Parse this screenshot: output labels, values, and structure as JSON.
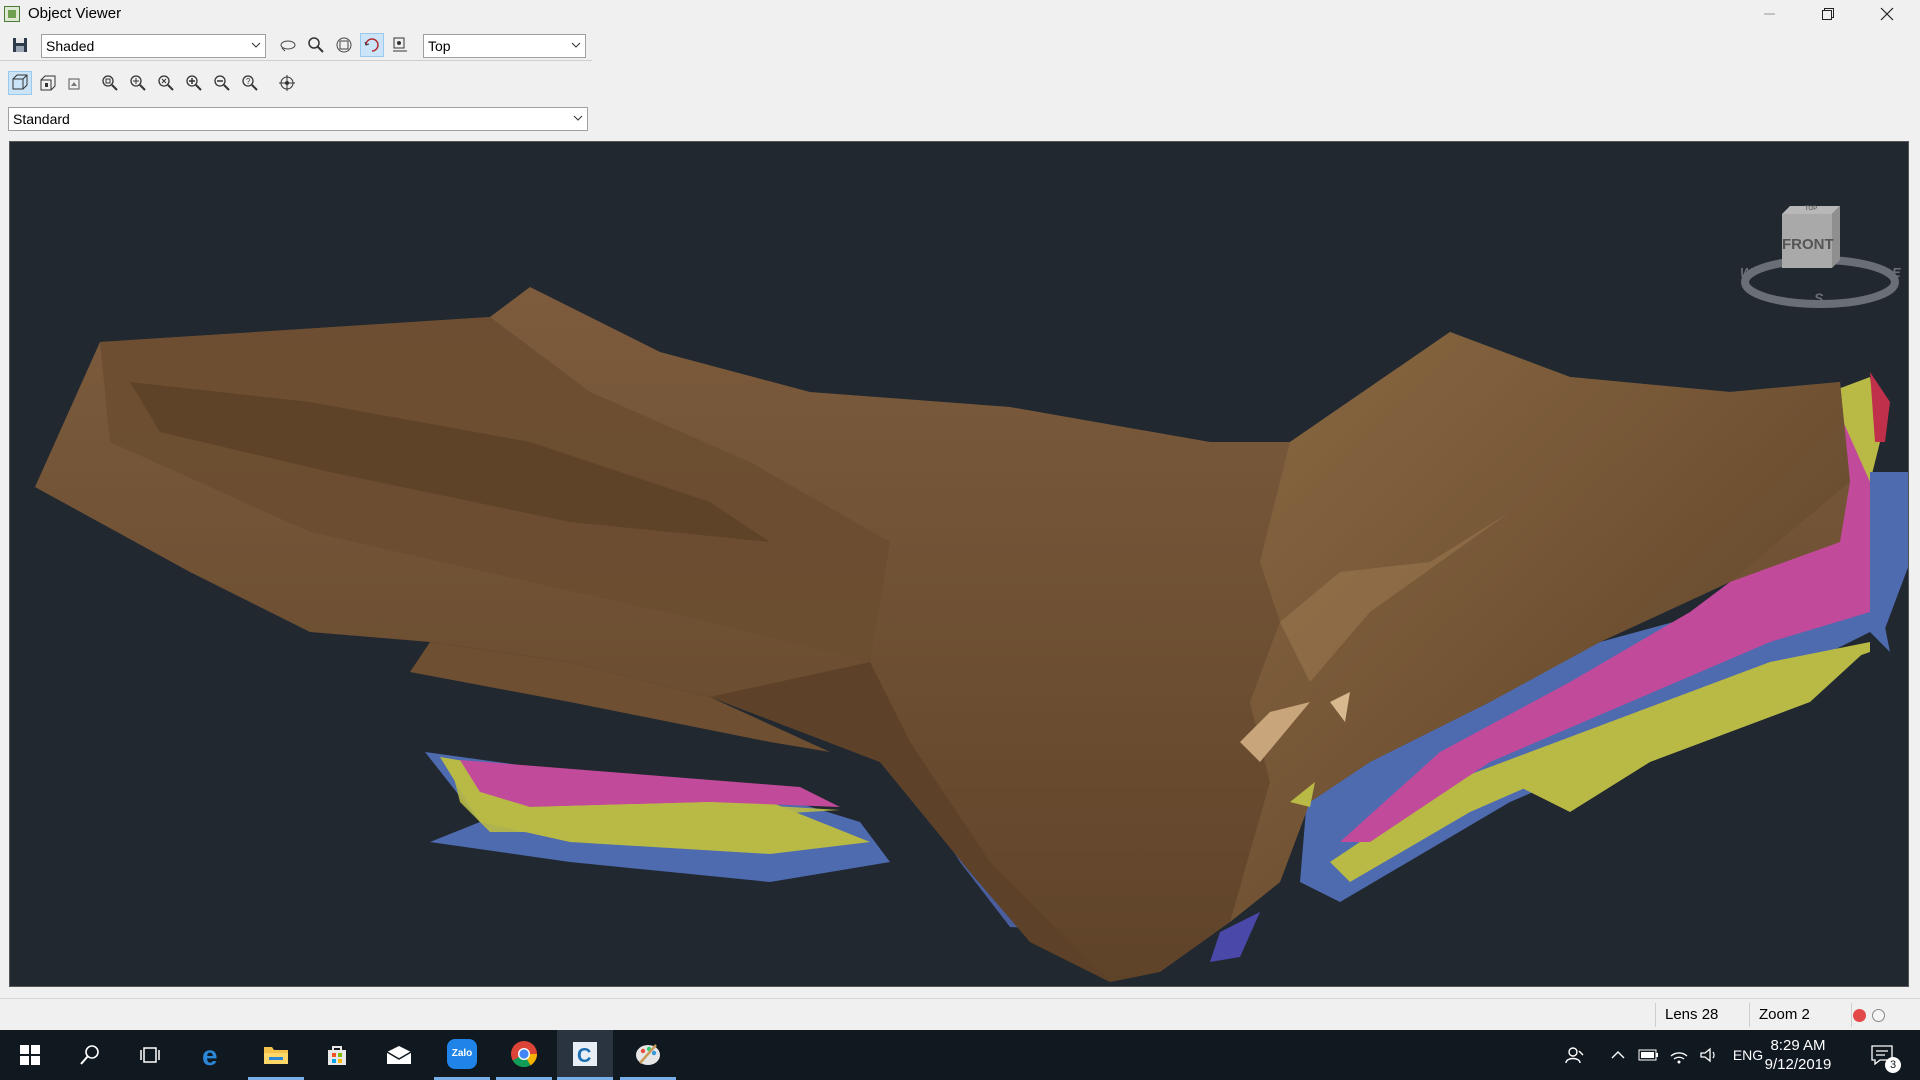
{
  "window": {
    "title": "Object Viewer"
  },
  "toolbar1": {
    "render_mode": "Shaded",
    "view_direction": "Top",
    "icons": [
      "save-icon",
      "orbit-icon",
      "zoom-glass-icon",
      "zoom-window-icon",
      "rotate-icon",
      "render-settings-icon"
    ]
  },
  "toolbar2": {
    "icons": [
      "box-view-icon",
      "box-side-view-icon",
      "object-view-icon",
      "zoom-extents-icon",
      "zoom-window2-icon",
      "zoom-object-icon",
      "zoom-in-icon",
      "zoom-out-icon",
      "zoom-previous-icon",
      "target-icon"
    ]
  },
  "style_select": {
    "value": "Standard"
  },
  "viewcube": {
    "face_label": "FRONT",
    "top_label": "TOP",
    "compass": {
      "w": "W",
      "e": "E",
      "s": "S"
    }
  },
  "status": {
    "lens": "Lens 28",
    "zoom": "Zoom 2"
  },
  "colors": {
    "viewport_bg": "#212830",
    "terrain": "#7a5a3c",
    "water": "#4a5e9e",
    "layer_pink": "#c24a9a",
    "layer_yellow": "#b9ba45",
    "layer_blue": "#4e6bb0"
  },
  "taskbar": {
    "apps": [
      "start-icon",
      "search-icon",
      "task-view-icon",
      "edge-icon",
      "file-explorer-icon",
      "store-icon",
      "mail-icon",
      "zalo-icon",
      "chrome-icon",
      "civil3d-icon",
      "paint-icon"
    ],
    "zalo_label": "Zalo",
    "language": "ENG",
    "time": "8:29 AM",
    "date": "9/12/2019",
    "notifications": "3"
  }
}
